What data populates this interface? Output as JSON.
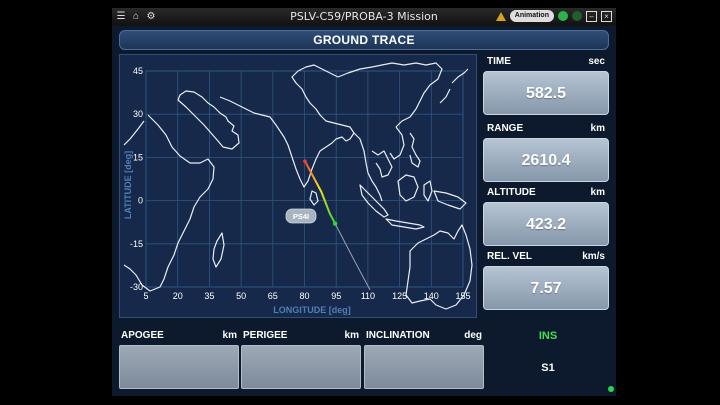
{
  "window": {
    "title": "PSLV-C59/PROBA-3 Mission",
    "animation_label": "Animation",
    "left_icons": [
      "menu-icon",
      "home-icon",
      "settings-icon"
    ],
    "right_icons": [
      "warning-icon",
      "status-green-icon",
      "status-dark-icon",
      "minimize-icon",
      "close-icon"
    ]
  },
  "header": {
    "title": "GROUND TRACE"
  },
  "map": {
    "xlabel": "LONGITUDE [deg]",
    "ylabel": "LATITUDE [deg]",
    "x_ticks": [
      "5",
      "20",
      "35",
      "50",
      "65",
      "80",
      "95",
      "110",
      "125",
      "140",
      "155"
    ],
    "y_ticks": [
      "45",
      "30",
      "15",
      "0",
      "-15",
      "-30"
    ],
    "vehicle_label": "PS4I",
    "colors": {
      "background": "#16294a",
      "grid": "#2f5683",
      "land": "#e8eef6",
      "trace_start": "#ff3d2e",
      "trace_mid": "#f4e11d",
      "trace_end": "#35d23a",
      "projection": "#9aa6b3"
    }
  },
  "chart_data": {
    "type": "line",
    "xlim": [
      5,
      155
    ],
    "ylim": [
      -30,
      45
    ],
    "grid": true,
    "series": [
      {
        "name": "",
        "x": [
          80.2,
          84.0,
          88.0,
          92.0,
          94.5
        ],
        "y": [
          13.7,
          8.5,
          3.0,
          -4.5,
          -8.0
        ]
      },
      {
        "name": "",
        "x": [
          94.5,
          103.0,
          111.0
        ],
        "y": [
          -8.0,
          -20.0,
          -31.0
        ]
      }
    ]
  },
  "readouts": [
    {
      "label": "TIME",
      "unit": "sec",
      "value": "582.5"
    },
    {
      "label": "RANGE",
      "unit": "km",
      "value": "2610.4"
    },
    {
      "label": "ALTITUDE",
      "unit": "km",
      "value": "423.2"
    },
    {
      "label": "REL. VEL",
      "unit": "km/s",
      "value": "7.57"
    }
  ],
  "bottom": [
    {
      "label": "APOGEE",
      "unit": "km",
      "value": ""
    },
    {
      "label": "PERIGEE",
      "unit": "km",
      "value": ""
    },
    {
      "label": "INCLINATION",
      "unit": "deg",
      "value": ""
    }
  ],
  "status": {
    "nav": "INS",
    "stage": "S1"
  }
}
